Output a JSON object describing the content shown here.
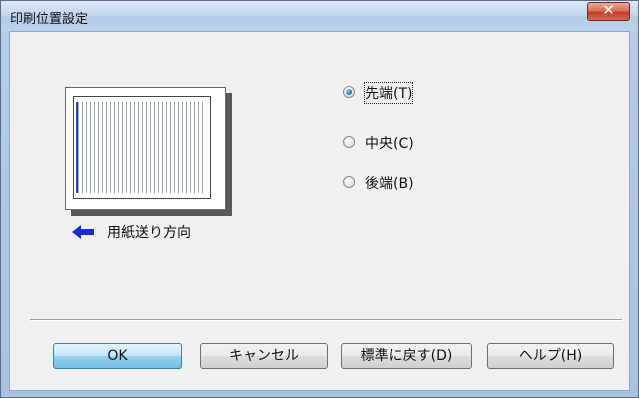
{
  "window": {
    "title": "印刷位置設定"
  },
  "preview": {
    "feed_label": "用紙送り方向"
  },
  "radios": [
    {
      "label": "先端(T)",
      "checked": true
    },
    {
      "label": "中央(C)",
      "checked": false
    },
    {
      "label": "後端(B)",
      "checked": false
    }
  ],
  "buttons": {
    "ok": "OK",
    "cancel": "キャンセル",
    "reset": "標準に戻す(D)",
    "help": "ヘルプ(H)"
  },
  "colors": {
    "feed_arrow": "#1a2bd6",
    "close_button": "#c8452e"
  }
}
